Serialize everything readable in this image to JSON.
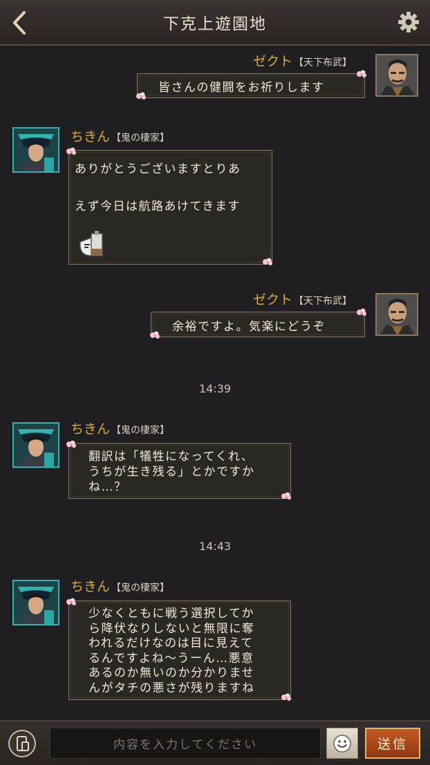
{
  "header": {
    "title": "下克上遊園地"
  },
  "messages": [
    {
      "name": "ゼクト",
      "clan": "【天下布武】",
      "text": "皆さんの健闘をお祈りします"
    },
    {
      "name": "ちきん",
      "clan": "【鬼の棲家】",
      "text": "ありがとうございますとりあ\n\nえず今日は航路あけてきます"
    },
    {
      "name": "ゼクト",
      "clan": "【天下布武】",
      "text": "余裕ですよ。気楽にどうぞ"
    },
    {
      "name": "ちきん",
      "clan": "【鬼の棲家】",
      "text": "翻訳は「犠牲になってくれ、\nうちが生き残る」とかですか\nね…？"
    },
    {
      "name": "ちきん",
      "clan": "【鬼の棲家】",
      "text": "少なくともに戦う選択してか\nら降伏なりしないと無限に奪\nわれるだけなのは目に見えて\nるんですよね〜うーん…悪意\nあるのか無いのか分かりませ\nんがタチの悪さが残りますね"
    }
  ],
  "timestamps": [
    "14:39",
    "14:43"
  ],
  "footer": {
    "placeholder": "内容を入力してください",
    "send_label": "送信"
  },
  "icons": {
    "back": "chevron-left-icon",
    "settings": "gear-icon",
    "phone": "phone-icon",
    "emoji": "smiley-icon",
    "sakura": "sakura-icon"
  },
  "colors": {
    "name": "#e0a93c",
    "accent_blue": "#36b2b2",
    "send": "#b24c1c"
  }
}
